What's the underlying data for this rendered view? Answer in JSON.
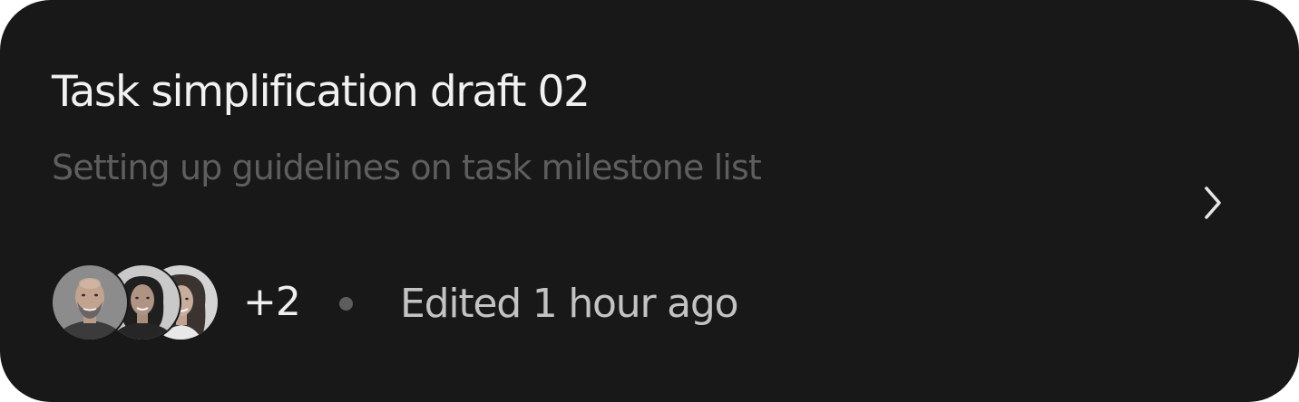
{
  "card": {
    "title": "Task simplification draft 02",
    "subtitle": "Setting up guidelines on task milestone list",
    "extra_count": "+2",
    "edited_text": "Edited 1 hour ago",
    "open_icon": "chevron-right-icon"
  },
  "colors": {
    "background": "#181818",
    "title": "#f1f1f1",
    "subtitle": "#5e5e5e",
    "meta": "#c3c3c3",
    "dot": "#5d5d5d"
  }
}
